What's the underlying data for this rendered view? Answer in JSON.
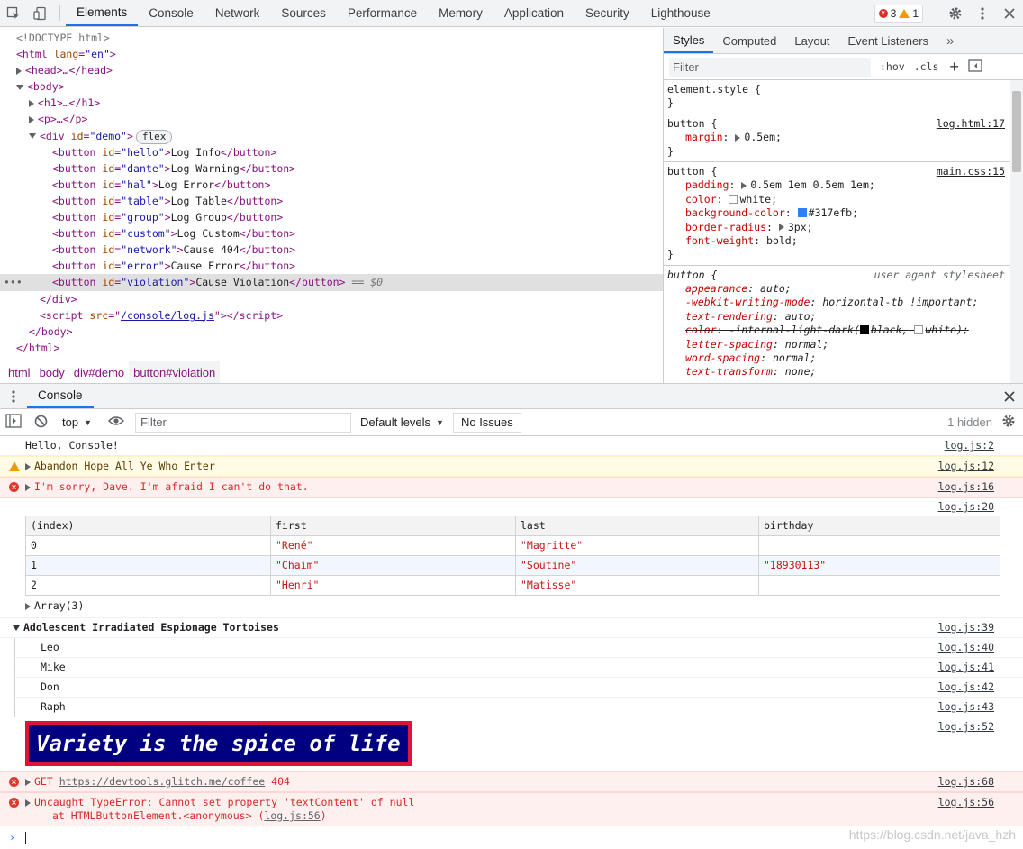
{
  "tabs": [
    "Elements",
    "Console",
    "Network",
    "Sources",
    "Performance",
    "Memory",
    "Application",
    "Security",
    "Lighthouse"
  ],
  "active_tab": "Elements",
  "issues": {
    "errors": "3",
    "warnings": "1"
  },
  "dom": {
    "doctype": "<!DOCTYPE html>",
    "html_open": "<html",
    "html_lang_attr": "lang",
    "html_lang_val": "\"en\"",
    "head": "<head>…</head>",
    "body_open": "<body>",
    "h1": "<h1>…</h1>",
    "p": "<p>…</p>",
    "div_open": "<div",
    "div_id_val": "\"demo\"",
    "flex_badge": "flex",
    "buttons": [
      {
        "id": "\"hello\"",
        "text": "Log Info"
      },
      {
        "id": "\"dante\"",
        "text": "Log Warning"
      },
      {
        "id": "\"hal\"",
        "text": "Log Error"
      },
      {
        "id": "\"table\"",
        "text": "Log Table"
      },
      {
        "id": "\"group\"",
        "text": "Log Group"
      },
      {
        "id": "\"custom\"",
        "text": "Log Custom"
      },
      {
        "id": "\"network\"",
        "text": "Cause 404"
      },
      {
        "id": "\"error\"",
        "text": "Cause Error"
      },
      {
        "id": "\"violation\"",
        "text": "Cause Violation"
      }
    ],
    "selected_suffix": "== $0",
    "div_close": "</div>",
    "script_src": "/console/log.js",
    "body_close": "</body>",
    "html_close": "</html>"
  },
  "breadcrumbs": [
    "html",
    "body",
    "div#demo",
    "button#violation"
  ],
  "styles": {
    "tabs": [
      "Styles",
      "Computed",
      "Layout",
      "Event Listeners"
    ],
    "filter_placeholder": "Filter",
    "hov": ":hov",
    "cls": ".cls",
    "element_style": "element.style {",
    "rule1": {
      "selector": "button {",
      "source": "log.html:17",
      "props": [
        {
          "name": "margin",
          "value": "0.5em;"
        }
      ]
    },
    "rule2": {
      "selector": "button {",
      "source": "main.css:15",
      "padding": "0.5em 1em 0.5em 1em;",
      "color": "white;",
      "bg_color": "#317efb;",
      "radius": "3px;",
      "weight": "bold;"
    },
    "rule3": {
      "selector": "button {",
      "source": "user agent stylesheet",
      "lines": [
        {
          "name": "appearance",
          "value": "auto;"
        },
        {
          "name": "-webkit-writing-mode",
          "value": "horizontal-tb !important;"
        },
        {
          "name": "text-rendering",
          "value": "auto;"
        },
        {
          "name": "letter-spacing",
          "value": "normal;"
        },
        {
          "name": "word-spacing",
          "value": "normal;"
        },
        {
          "name": "text-transform",
          "value": "none;"
        }
      ],
      "struck": {
        "name": "color",
        "value": "-internal-light-dark(",
        "v1": "black,",
        "v2": "white);"
      }
    }
  },
  "drawer": {
    "tab": "Console"
  },
  "console_toolbar": {
    "context": "top",
    "filter_placeholder": "Filter",
    "levels": "Default levels",
    "no_issues": "No Issues",
    "hidden": "1 hidden"
  },
  "console": {
    "m1": {
      "text": "Hello, Console!",
      "src": "log.js:2"
    },
    "m2": {
      "text": "Abandon Hope All Ye Who Enter",
      "src": "log.js:12"
    },
    "m3": {
      "text": "I'm sorry, Dave. I'm afraid I can't do that.",
      "src": "log.js:16"
    },
    "table_src": "log.js:20",
    "table_headers": [
      "(index)",
      "first",
      "last",
      "birthday"
    ],
    "table_rows": [
      [
        "0",
        "\"René\"",
        "\"Magritte\"",
        ""
      ],
      [
        "1",
        "\"Chaim\"",
        "\"Soutine\"",
        "\"18930113\""
      ],
      [
        "2",
        "\"Henri\"",
        "\"Matisse\"",
        ""
      ]
    ],
    "array_label": "Array(3)",
    "group": {
      "title": "Adolescent Irradiated Espionage Tortoises",
      "src": "log.js:39"
    },
    "group_items": [
      {
        "text": "Leo",
        "src": "log.js:40"
      },
      {
        "text": "Mike",
        "src": "log.js:41"
      },
      {
        "text": "Don",
        "src": "log.js:42"
      },
      {
        "text": "Raph",
        "src": "log.js:43"
      }
    ],
    "custom": {
      "text": "Variety is the spice of life",
      "src": "log.js:52"
    },
    "e404": {
      "prefix": "GET",
      "url": "https://devtools.glitch.me/coffee",
      "code": "404",
      "src": "log.js:68"
    },
    "etype": {
      "line1": "Uncaught TypeError: Cannot set property 'textContent' of null",
      "line2_prefix": "at HTMLButtonElement.<anonymous> (",
      "line2_link": "log.js:56",
      "line2_suffix": ")",
      "src": "log.js:56"
    }
  },
  "watermark": "https://blog.csdn.net/java_hzh",
  "colors": {
    "accent": "#1a73e8",
    "error": "#d93025",
    "warning": "#f29900",
    "swatch_blue": "#317efb"
  }
}
